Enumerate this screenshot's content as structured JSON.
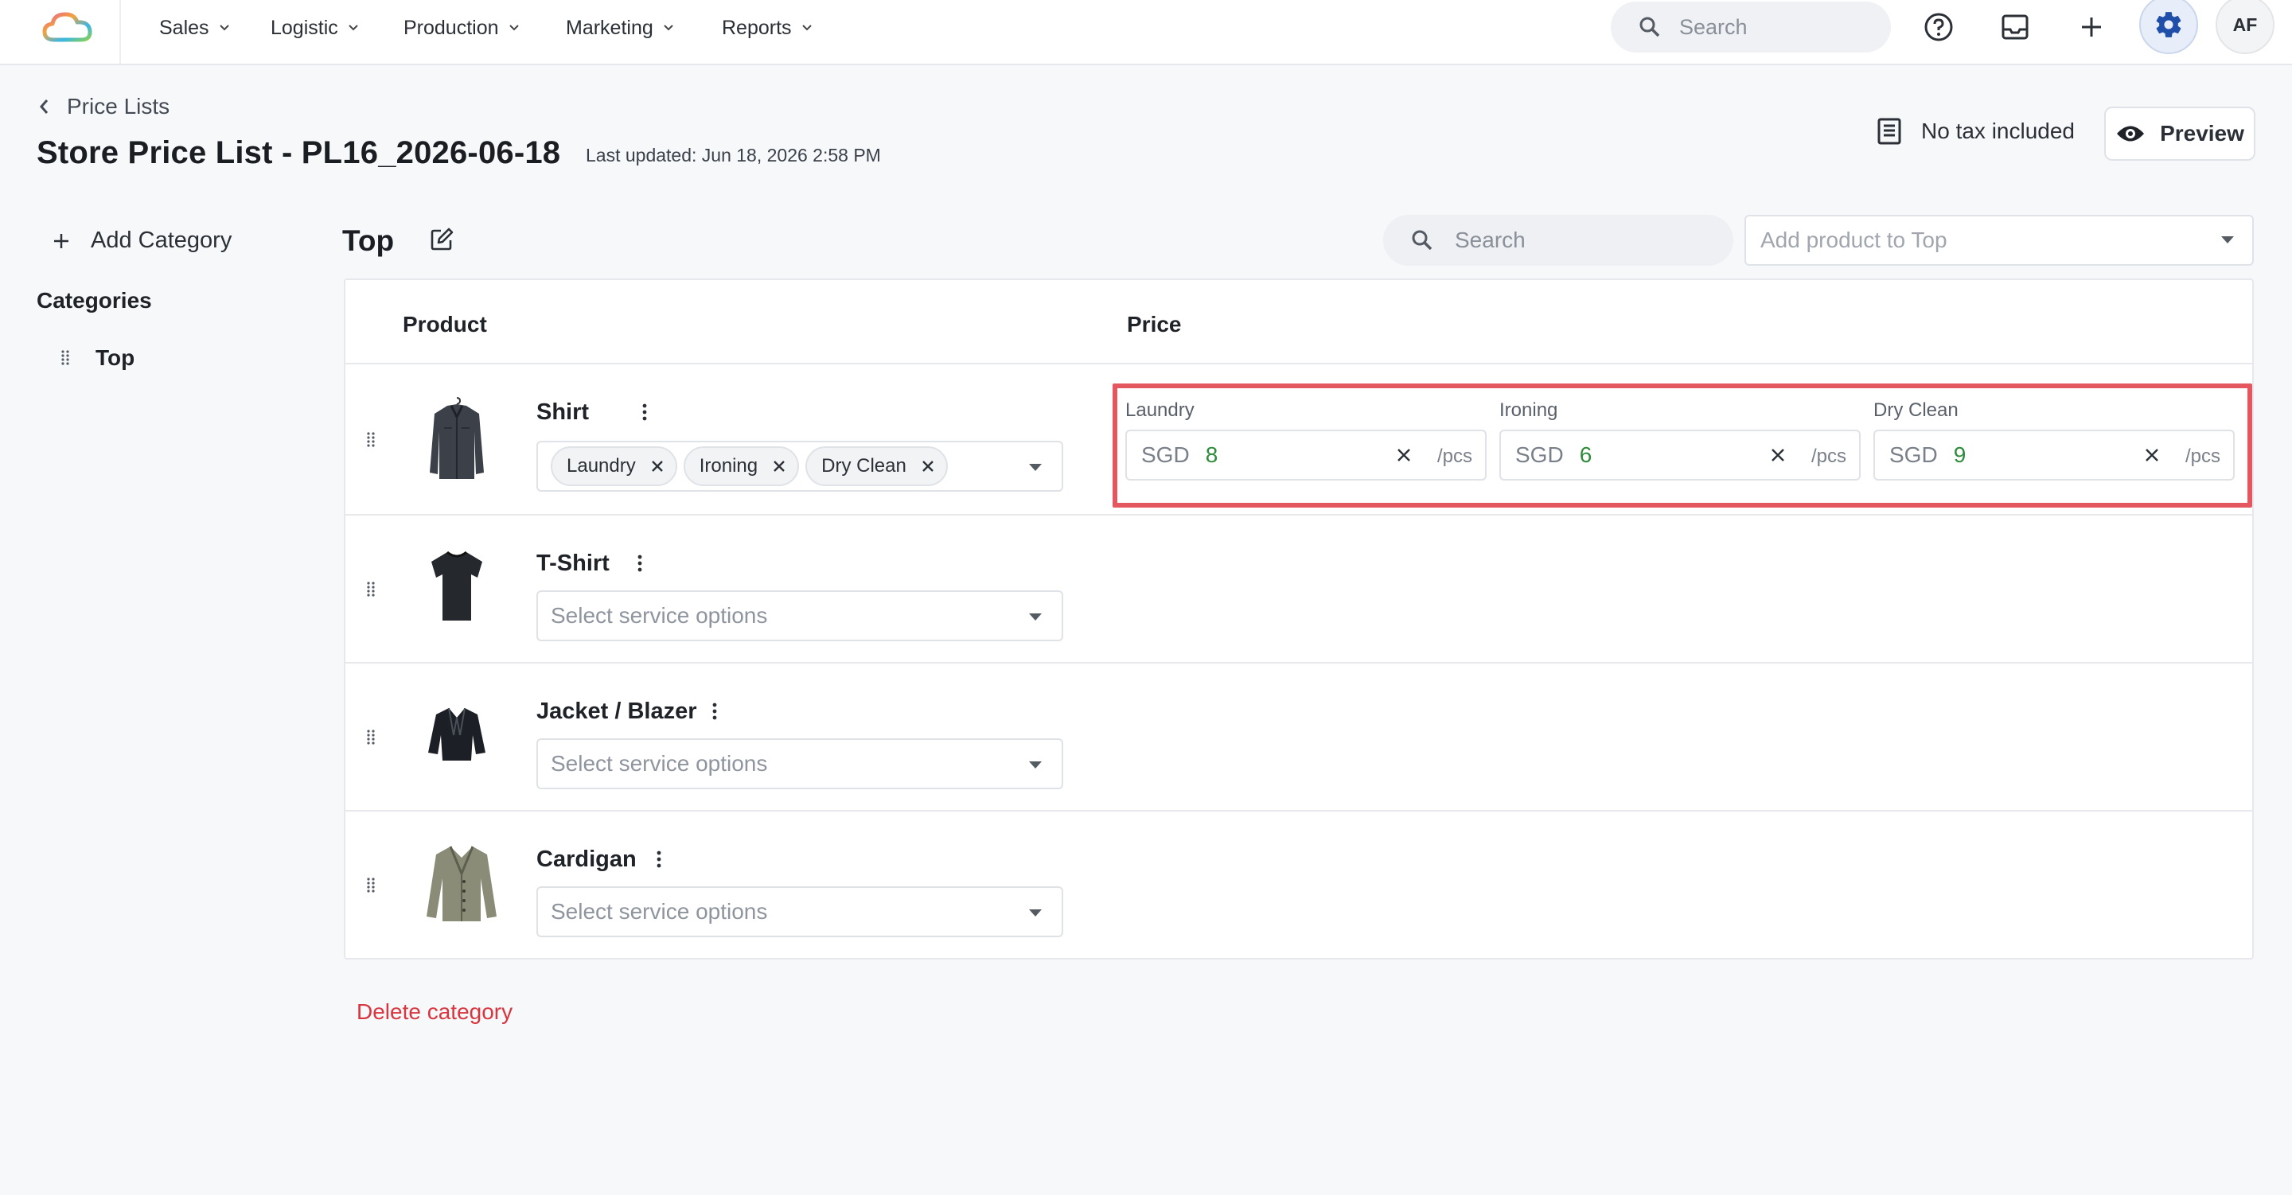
{
  "nav": {
    "items": [
      {
        "label": "Sales"
      },
      {
        "label": "Logistic"
      },
      {
        "label": "Production"
      },
      {
        "label": "Marketing"
      },
      {
        "label": "Reports"
      }
    ],
    "search_placeholder": "Search",
    "avatar_initials": "AF"
  },
  "header": {
    "back_label": "Price Lists",
    "title": "Store Price List - PL16_2026-06-18",
    "last_updated": "Last updated: Jun 18, 2026 2:58 PM",
    "tax_label": "No tax included",
    "preview_label": "Preview"
  },
  "sidebar": {
    "add_category_label": "Add Category",
    "categories_heading": "Categories",
    "items": [
      {
        "label": "Top"
      }
    ]
  },
  "main": {
    "category_title": "Top",
    "search_placeholder": "Search",
    "add_product_placeholder": "Add product to Top",
    "columns": {
      "product": "Product",
      "price": "Price"
    },
    "select_placeholder": "Select service options",
    "products": [
      {
        "name": "Shirt",
        "services": [
          "Laundry",
          "Ironing",
          "Dry Clean"
        ],
        "prices": [
          {
            "service": "Laundry",
            "currency": "SGD",
            "value": "8",
            "unit": "/pcs"
          },
          {
            "service": "Ironing",
            "currency": "SGD",
            "value": "6",
            "unit": "/pcs"
          },
          {
            "service": "Dry Clean",
            "currency": "SGD",
            "value": "9",
            "unit": "/pcs"
          }
        ]
      },
      {
        "name": "T-Shirt"
      },
      {
        "name": "Jacket / Blazer"
      },
      {
        "name": "Cardigan"
      }
    ],
    "delete_label": "Delete category"
  },
  "colors": {
    "accent": "#1f4fa8",
    "highlight": "#e4575f",
    "price_value": "#2e8b3c",
    "danger": "#d8363f"
  },
  "icons": [
    "cloud-logo-icon",
    "chevron-down-icon",
    "search-icon",
    "help-icon",
    "inbox-icon",
    "plus-icon",
    "gear-icon",
    "back-chevron-icon",
    "receipt-icon",
    "eye-icon",
    "edit-icon",
    "drag-handle-icon",
    "kebab-icon",
    "close-icon",
    "caret-down-icon"
  ]
}
